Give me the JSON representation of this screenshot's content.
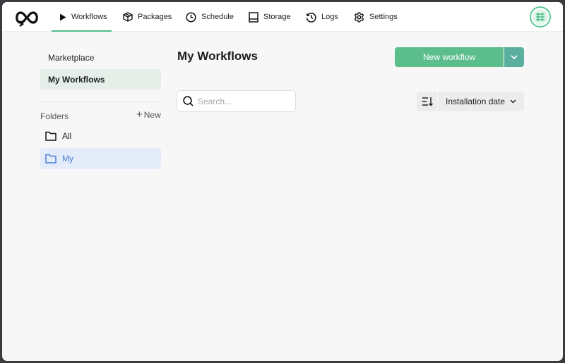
{
  "nav": {
    "items": [
      {
        "label": "Workflows",
        "icon": "play-icon",
        "active": true
      },
      {
        "label": "Packages",
        "icon": "package-icon"
      },
      {
        "label": "Schedule",
        "icon": "clock-icon"
      },
      {
        "label": "Storage",
        "icon": "storage-icon"
      },
      {
        "label": "Logs",
        "icon": "history-icon"
      },
      {
        "label": "Settings",
        "icon": "gear-icon"
      }
    ]
  },
  "sidebar": {
    "links": [
      {
        "label": "Marketplace"
      },
      {
        "label": "My Workflows",
        "selected": true
      }
    ],
    "folders_label": "Folders",
    "new_label": "New",
    "folders": [
      {
        "label": "All"
      },
      {
        "label": "My",
        "selected": true
      }
    ]
  },
  "main": {
    "title": "My Workflows",
    "new_button_label": "New workflow",
    "search_placeholder": "Search...",
    "sort_label": "Installation date"
  },
  "colors": {
    "accent": "#5cbe8c",
    "accent_dark": "#5aaf9e",
    "selected_folder": "#4a7fd8"
  }
}
